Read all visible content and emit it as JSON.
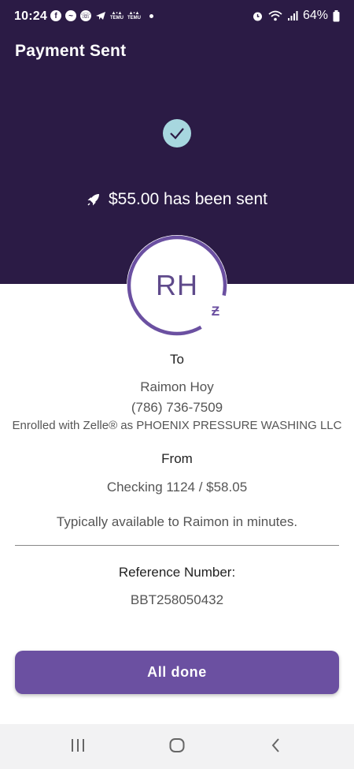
{
  "status_bar": {
    "time": "10:24",
    "left_icons": [
      "facebook-icon",
      "messenger-icon",
      "whatsapp-icon",
      "telegram-icon",
      "temu-icon",
      "temu-icon"
    ],
    "temu_label": "TEMU",
    "battery": "64%"
  },
  "header": {
    "title": "Payment Sent",
    "sent_message": "$55.00 has been sent"
  },
  "recipient": {
    "initials": "RH",
    "to_label": "To",
    "name": "Raimon Hoy",
    "phone": "(786) 736-7509",
    "enrolled": "Enrolled with Zelle® as PHOENIX PRESSURE WASHING LLC"
  },
  "source": {
    "from_label": "From",
    "account": "Checking 1124 / $58.05",
    "availability": "Typically available to Raimon in minutes."
  },
  "reference": {
    "label": "Reference Number:",
    "number": "BBT258050432"
  },
  "actions": {
    "done_label": "All done"
  },
  "colors": {
    "header_bg": "#2b1b45",
    "accent": "#6b50a1",
    "check_bg": "#a7d7df"
  }
}
